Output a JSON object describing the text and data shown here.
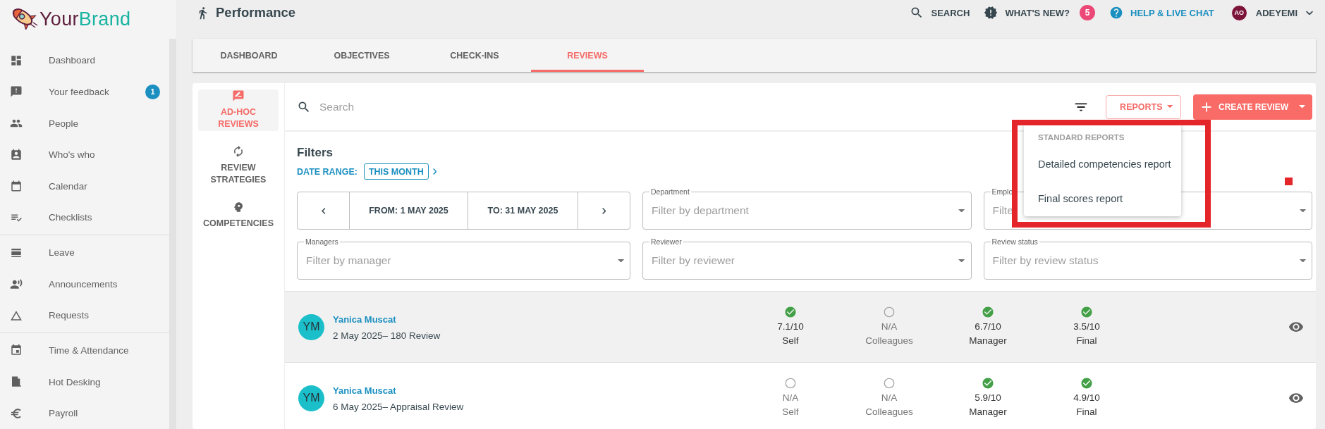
{
  "brand": {
    "first": "Your",
    "second": "Brand"
  },
  "sidebar": {
    "groups": [
      [
        {
          "label": "Dashboard"
        },
        {
          "label": "Your feedback",
          "badge": "1"
        },
        {
          "label": "People"
        },
        {
          "label": "Who's who"
        },
        {
          "label": "Calendar"
        },
        {
          "label": "Checklists"
        }
      ],
      [
        {
          "label": "Leave"
        },
        {
          "label": "Announcements"
        },
        {
          "label": "Requests"
        }
      ],
      [
        {
          "label": "Time & Attendance"
        },
        {
          "label": "Hot Desking"
        },
        {
          "label": "Payroll"
        }
      ]
    ]
  },
  "header": {
    "title": "Performance",
    "actions": [
      {
        "kind": "search",
        "label": "SEARCH"
      },
      {
        "kind": "news",
        "label": "WHAT'S NEW?",
        "badge": "5"
      },
      {
        "kind": "help",
        "label": "HELP & LIVE CHAT"
      }
    ],
    "user": {
      "initials": "AO",
      "name": "ADEYEMI"
    }
  },
  "tabs": [
    {
      "label": "DASHBOARD",
      "selected": false
    },
    {
      "label": "OBJECTIVES",
      "selected": false
    },
    {
      "label": "CHECK-INS",
      "selected": false
    },
    {
      "label": "REVIEWS",
      "selected": true
    }
  ],
  "review_nav": [
    {
      "label": "AD-HOC REVIEWS",
      "selected": true
    },
    {
      "label": "REVIEW STRATEGIES",
      "selected": false
    },
    {
      "label": "COMPETENCIES",
      "selected": false
    }
  ],
  "search": {
    "placeholder": "Search"
  },
  "reports_button": {
    "label": "REPORTS"
  },
  "create_button": {
    "label": "CREATE REVIEW"
  },
  "reports_menu": {
    "heading": "STANDARD REPORTS",
    "items": [
      "Detailed competencies report",
      "Final scores report"
    ]
  },
  "filters": {
    "title": "Filters",
    "date_range": {
      "label": "DATE RANGE:",
      "value": "THIS MONTH"
    },
    "period": {
      "from": "FROM: 1 MAY 2025",
      "to": "TO: 31 MAY 2025"
    },
    "fields": [
      {
        "label": "Department",
        "placeholder": "Filter by department"
      },
      {
        "label": "Emplo",
        "placeholder": "Filte"
      },
      {
        "label": "Managers",
        "placeholder": "Filter by manager"
      },
      {
        "label": "Reviewer",
        "placeholder": "Filter by reviewer"
      },
      {
        "label": "Review status",
        "placeholder": "Filter by review status"
      }
    ]
  },
  "reviews": [
    {
      "highlighted": true,
      "initials": "YM",
      "name": "Yanica Muscat",
      "detail": "2 May 2025– 180 Review",
      "scores": [
        {
          "completed": true,
          "value": "7.1/10",
          "label": "Self"
        },
        {
          "completed": false,
          "value": "N/A",
          "label": "Colleagues"
        },
        {
          "completed": true,
          "value": "6.7/10",
          "label": "Manager"
        },
        {
          "completed": true,
          "value": "3.5/10",
          "label": "Final"
        }
      ]
    },
    {
      "highlighted": false,
      "initials": "YM",
      "name": "Yanica Muscat",
      "detail": "6 May 2025– Appraisal Review",
      "scores": [
        {
          "completed": false,
          "value": "N/A",
          "label": "Self"
        },
        {
          "completed": false,
          "value": "N/A",
          "label": "Colleagues"
        },
        {
          "completed": true,
          "value": "5.9/10",
          "label": "Manager"
        },
        {
          "completed": true,
          "value": "4.9/10",
          "label": "Final"
        }
      ]
    }
  ]
}
